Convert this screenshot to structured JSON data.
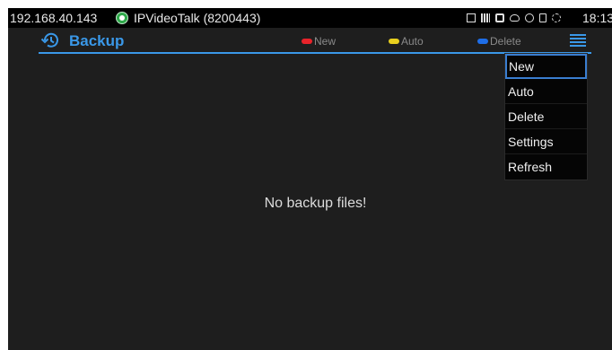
{
  "status_bar": {
    "ip": "192.168.40.143",
    "app_label": "IPVideoTalk (8200443)",
    "time": "18:13",
    "icons": [
      "image-icon",
      "ethernet-icon",
      "lock-icon",
      "cloud-icon",
      "bluetooth-icon",
      "sd-card-icon",
      "sync-icon"
    ]
  },
  "header": {
    "title": "Backup",
    "back_icon": "history-icon",
    "legend": [
      {
        "label": "New",
        "color": "#e8232a"
      },
      {
        "label": "Auto",
        "color": "#e8cf1e"
      },
      {
        "label": "Delete",
        "color": "#1e6ee8"
      }
    ],
    "menu_icon": "menu-icon"
  },
  "main": {
    "empty_message": "No backup files!"
  },
  "menu": {
    "items": [
      "New",
      "Auto",
      "Delete",
      "Settings",
      "Refresh"
    ]
  },
  "colors": {
    "accent": "#3a98e8",
    "background": "#1e1e1e",
    "status_bar": "#000000"
  }
}
